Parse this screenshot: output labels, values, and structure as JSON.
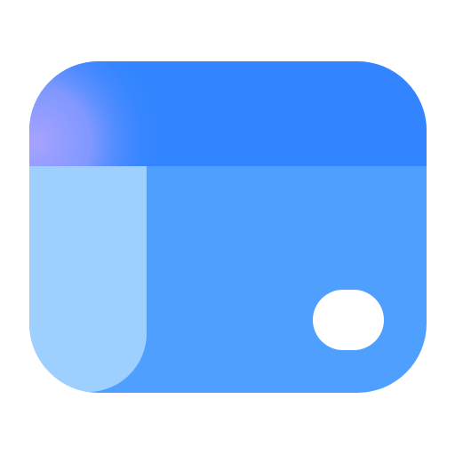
{
  "icon": {
    "name": "window-panel-app-icon",
    "colors": {
      "header": "#3385FF",
      "header_glow": "#A7A3FF",
      "body": "#4F9FFF",
      "sidebar": "#9ED0FF",
      "dot": "#FFFFFF",
      "background": "#FFFFFF"
    }
  }
}
